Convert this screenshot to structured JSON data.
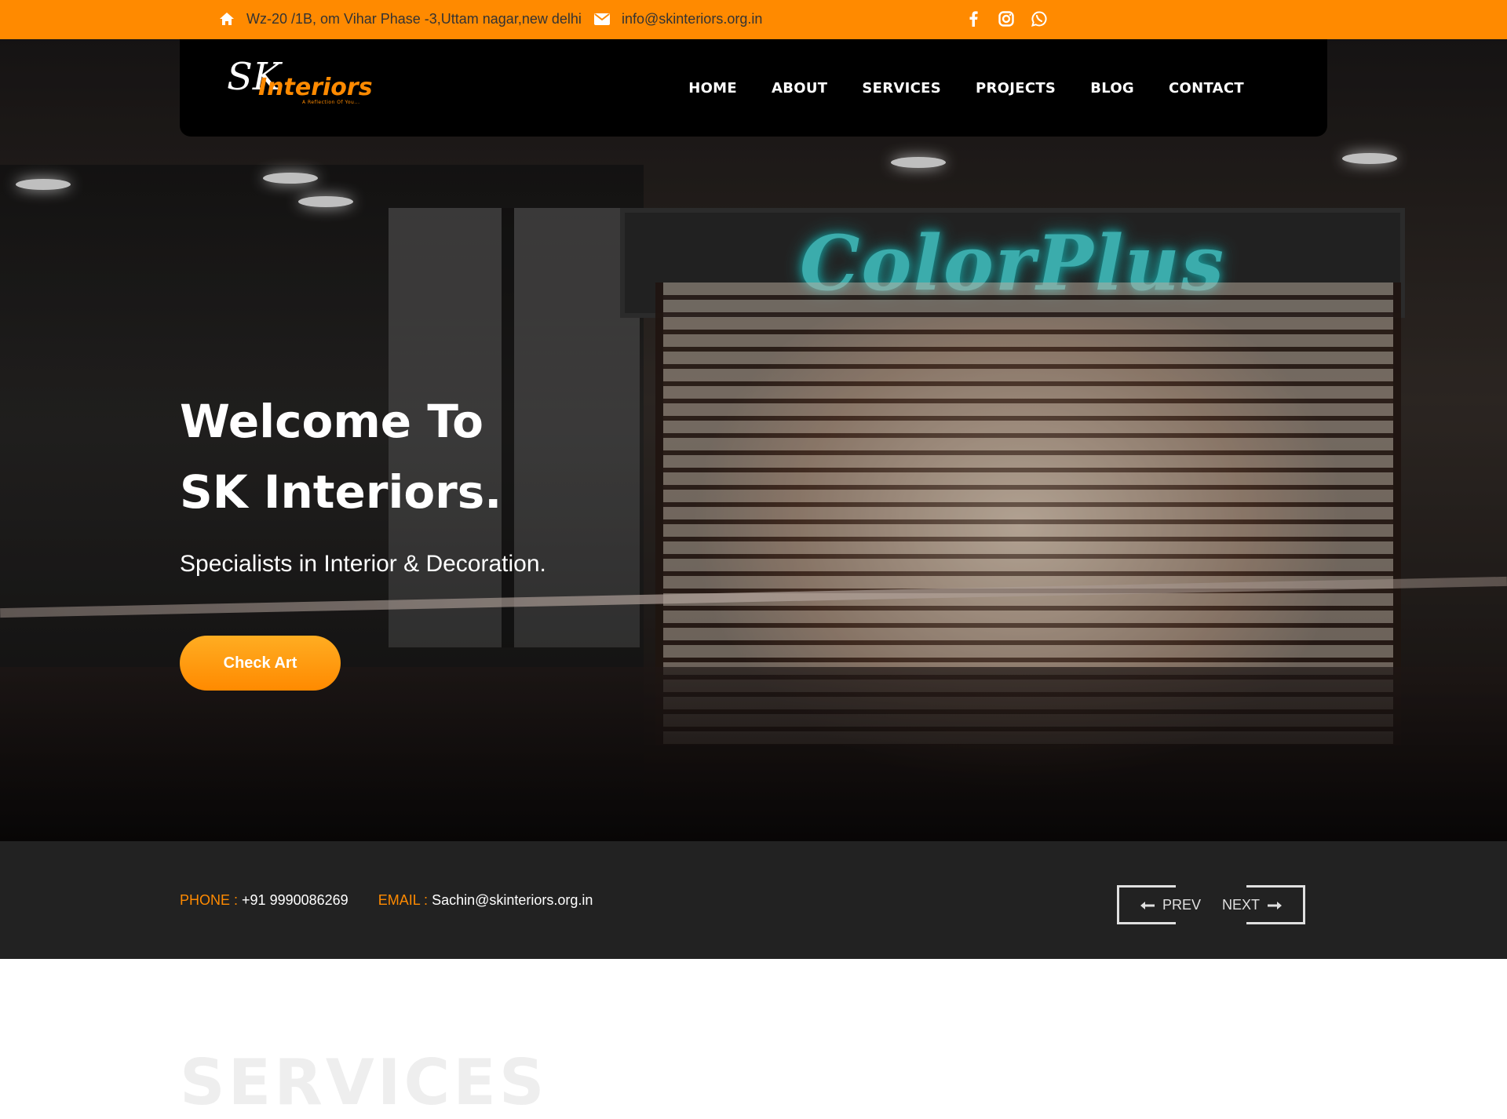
{
  "topbar": {
    "address": "Wz-20 /1B, om Vihar Phase -3,Uttam nagar,new delhi",
    "email": "info@skinteriors.org.in",
    "social_icons": [
      "facebook-icon",
      "instagram-icon",
      "whatsapp-icon"
    ]
  },
  "logo": {
    "mark": "SK",
    "brand": "Interiors",
    "tagline": "A Reflection Of You..."
  },
  "nav": {
    "items": [
      "HOME",
      "ABOUT",
      "SERVICES",
      "PROJECTS",
      "BLOG",
      "CONTACT"
    ]
  },
  "hero": {
    "title_line1": "Welcome To",
    "title_line2": "SK Interiors.",
    "subtitle": "Specialists in Interior & Decoration.",
    "cta": "Check Art",
    "sign_text": "ColorPlus"
  },
  "info": {
    "phone_label": "PHONE :",
    "phone": "+91 9990086269",
    "email_label": "EMAIL :",
    "email": "Sachin@skinteriors.org.in",
    "prev": "PREV",
    "next": "NEXT"
  },
  "section": {
    "services_heading": "SERVICES"
  },
  "colors": {
    "accent": "#ff8a00",
    "navbar": "#000000",
    "strip": "#222222",
    "sign_glow": "#4fe6e6"
  }
}
